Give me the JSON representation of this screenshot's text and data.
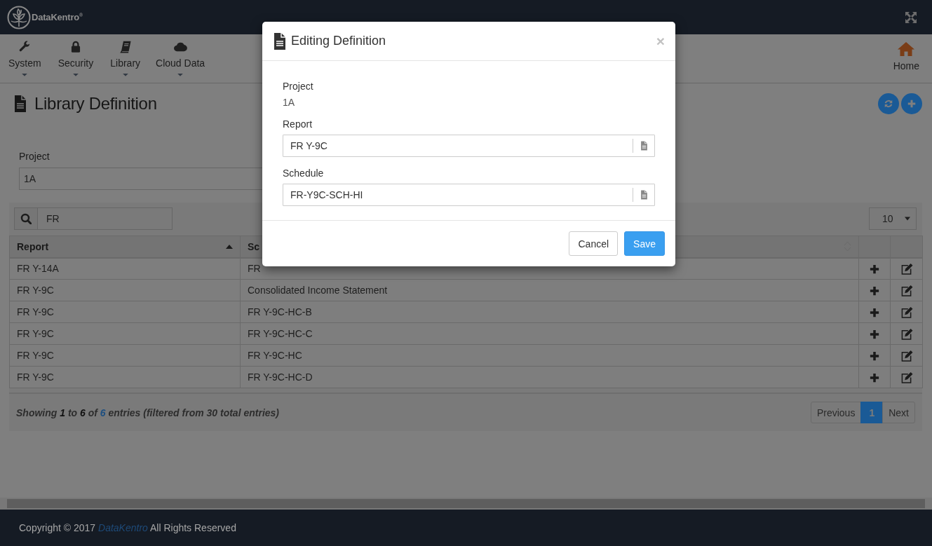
{
  "brand": {
    "name": "DataKentro$^{®}$"
  },
  "nav": [
    {
      "label": "System"
    },
    {
      "label": "Security"
    },
    {
      "label": "Library"
    },
    {
      "label": "Cloud Data"
    }
  ],
  "home": {
    "label": "Home"
  },
  "page_title": "Library Definition",
  "filter": {
    "label": "Project",
    "value": "1A"
  },
  "search": {
    "value": "FR"
  },
  "page_size": {
    "value": "10"
  },
  "table": {
    "columns": [
      {
        "label": "Report",
        "sorted": true
      },
      {
        "label": "Sc",
        "sorted": false
      }
    ],
    "rows": [
      {
        "report": "FR Y-14A",
        "schedule": "FR"
      },
      {
        "report": "FR Y-9C",
        "schedule": "Consolidated Income Statement"
      },
      {
        "report": "FR Y-9C",
        "schedule": "FR Y-9C-HC-B"
      },
      {
        "report": "FR Y-9C",
        "schedule": "FR Y-9C-HC-C"
      },
      {
        "report": "FR Y-9C",
        "schedule": "FR Y-9C-HC"
      },
      {
        "report": "FR Y-9C",
        "schedule": "FR Y-9C-HC-D"
      }
    ]
  },
  "summary": [
    {
      "kind": "text",
      "text": "Showing "
    },
    {
      "kind": "strong",
      "text": "1"
    },
    {
      "kind": "text",
      "text": " to "
    },
    {
      "kind": "strong",
      "text": "6"
    },
    {
      "kind": "text",
      "text": " of "
    },
    {
      "kind": "accent",
      "text": "6"
    },
    {
      "kind": "text",
      "text": " entries (filtered from 30 total entries)"
    }
  ],
  "pagination": [
    {
      "label": "Previous",
      "selected": false
    },
    {
      "label": "1",
      "selected": true
    },
    {
      "label": "Next",
      "selected": false
    }
  ],
  "modal": {
    "title": "Editing Definition",
    "close": "×",
    "fields": [
      {
        "kind": "static",
        "label": "Project",
        "value": "1A"
      },
      {
        "kind": "lookup",
        "label": "Report",
        "value": "FR Y-9C"
      },
      {
        "kind": "lookup",
        "label": "Schedule",
        "value": "FR-Y9C-SCH-HI"
      }
    ],
    "buttons": [
      {
        "kind": "default",
        "label": "Cancel"
      },
      {
        "kind": "primary",
        "label": "Save"
      }
    ]
  },
  "footer": {
    "before": "Copyright © 2017 ",
    "link": "DataKentro",
    "after": " All Rights Reserved"
  }
}
